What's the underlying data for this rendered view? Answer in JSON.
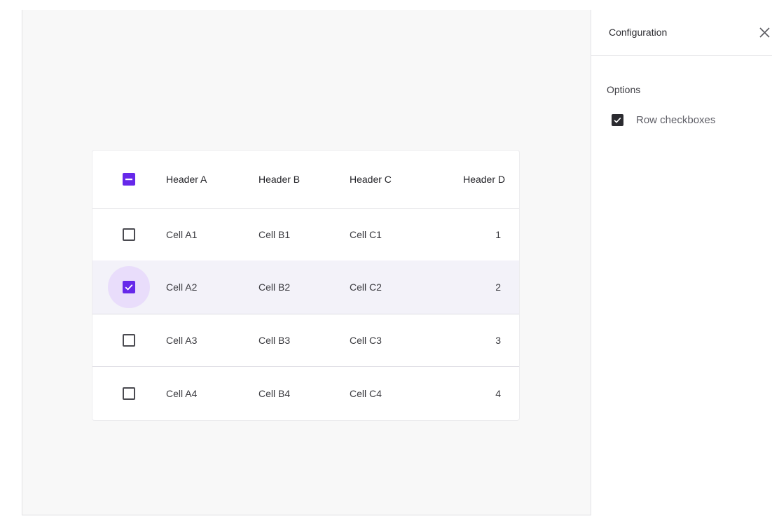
{
  "panel": {
    "title": "Configuration",
    "close_icon": "close-icon",
    "section_label": "Options",
    "options": [
      {
        "label": "Row checkboxes",
        "checked": true
      }
    ]
  },
  "table": {
    "headers": [
      "Header A",
      "Header B",
      "Header C",
      "Header D"
    ],
    "header_checkbox_state": "indeterminate",
    "rows": [
      {
        "a": "Cell A1",
        "b": "Cell B1",
        "c": "Cell C1",
        "d": "1",
        "checked": false
      },
      {
        "a": "Cell A2",
        "b": "Cell B2",
        "c": "Cell C2",
        "d": "2",
        "checked": true
      },
      {
        "a": "Cell A3",
        "b": "Cell B3",
        "c": "Cell C3",
        "d": "3",
        "checked": false
      },
      {
        "a": "Cell A4",
        "b": "Cell B4",
        "c": "Cell C4",
        "d": "4",
        "checked": false
      }
    ]
  },
  "colors": {
    "accent": "#6628ea",
    "selected_row": "#f3f2f9",
    "focus_ring": "#e9ddfb",
    "canvas_bg": "#f8f8f8"
  }
}
